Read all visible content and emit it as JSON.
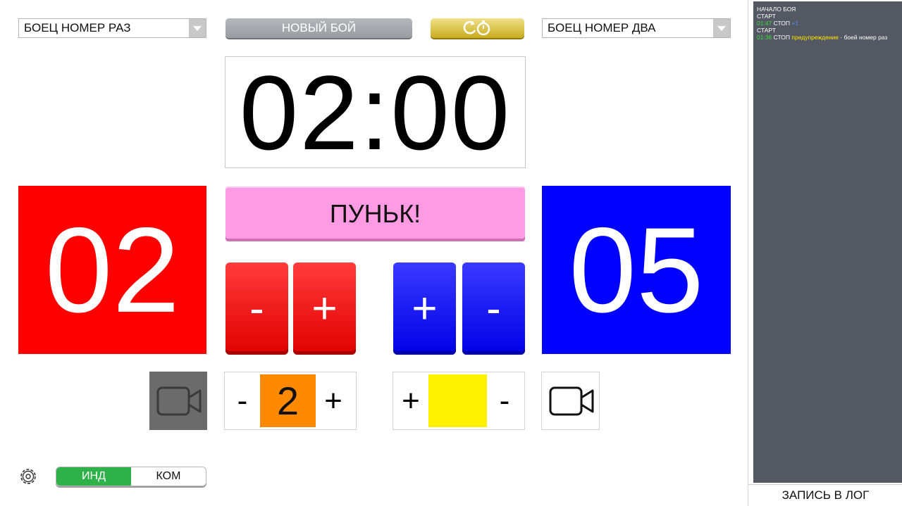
{
  "top": {
    "fighter_one": "БОЕЦ НОМЕР РАЗ",
    "new_fight": "НОВЫЙ БОЙ",
    "fighter_two": "БОЕЦ НОМЕР ДВА"
  },
  "timer": {
    "value": "02:00"
  },
  "scores": {
    "red": "02",
    "blue": "05"
  },
  "punk_label": "ПУНЬК!",
  "red_buttons": {
    "minus": "-",
    "plus": "+"
  },
  "blue_buttons": {
    "plus": "+",
    "minus": "-"
  },
  "counters": {
    "left": {
      "minus": "-",
      "value": "2",
      "plus": "+",
      "color": "#ff8a00"
    },
    "right": {
      "plus": "+",
      "value": "",
      "minus": "-",
      "color": "#fff200"
    }
  },
  "mode_toggle": {
    "individual": "ИНД",
    "team": "КОМ"
  },
  "log": {
    "lines": [
      {
        "parts": [
          {
            "text": "НАЧАЛО БОЯ",
            "color": "white"
          }
        ]
      },
      {
        "parts": [
          {
            "text": "СТАРТ",
            "color": "white"
          }
        ]
      },
      {
        "parts": [
          {
            "text": "01:47",
            "color": "green"
          },
          {
            "text": " СТОП ",
            "color": "white"
          },
          {
            "text": "+1",
            "color": "blue"
          }
        ]
      },
      {
        "parts": [
          {
            "text": "СТАРТ",
            "color": "white"
          }
        ]
      },
      {
        "parts": [
          {
            "text": "01:36",
            "color": "green"
          },
          {
            "text": " СТОП ",
            "color": "white"
          },
          {
            "text": "предупреждение",
            "color": "yellow"
          },
          {
            "text": " · ",
            "color": "white"
          },
          {
            "text": "боей номер раз",
            "color": "white"
          }
        ]
      }
    ],
    "write_button": "ЗАПИСЬ В ЛОГ"
  },
  "colors": {
    "red": "#ff0000",
    "blue": "#0000ff",
    "pink": "#ff9be3",
    "green": "#2fb14a",
    "log_bg": "#545862"
  }
}
